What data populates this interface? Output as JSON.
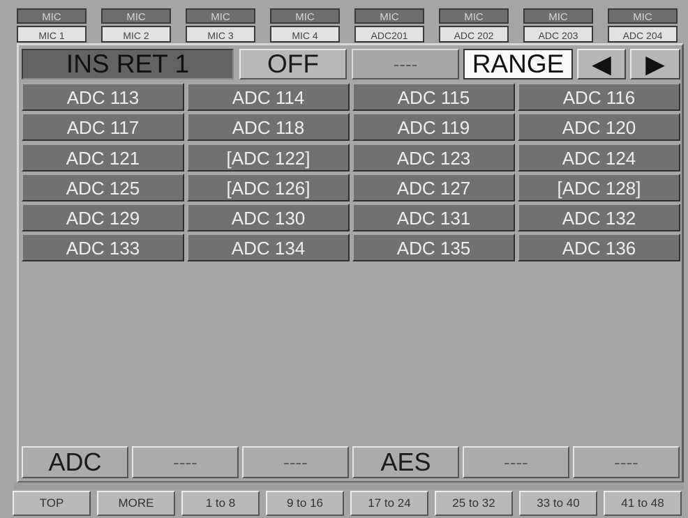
{
  "channel_strip": [
    {
      "category": "MIC",
      "name": "MIC 1"
    },
    {
      "category": "MIC",
      "name": "MIC 2"
    },
    {
      "category": "MIC",
      "name": "MIC 3"
    },
    {
      "category": "MIC",
      "name": "MIC 4"
    },
    {
      "category": "MIC",
      "name": "ADC201"
    },
    {
      "category": "MIC",
      "name": "ADC 202"
    },
    {
      "category": "MIC",
      "name": "ADC 203"
    },
    {
      "category": "MIC",
      "name": "ADC 204"
    }
  ],
  "popup": {
    "title": "INS RET 1",
    "off_label": "OFF",
    "dash_label": "----",
    "range_label": "RANGE",
    "prev_icon": "◀",
    "next_icon": "▶"
  },
  "patch_grid": [
    [
      "ADC 113",
      "ADC 114",
      "ADC 115",
      "ADC 116"
    ],
    [
      "ADC 117",
      "ADC 118",
      "ADC 119",
      "ADC 120"
    ],
    [
      "ADC 121",
      "[ADC 122]",
      "ADC 123",
      "ADC 124"
    ],
    [
      "ADC 125",
      "[ADC 126]",
      "ADC 127",
      "[ADC 128]"
    ],
    [
      "ADC 129",
      "ADC 130",
      "ADC 131",
      "ADC 132"
    ],
    [
      "ADC 133",
      "ADC 134",
      "ADC 135",
      "ADC 136"
    ]
  ],
  "categories": [
    "ADC",
    "----",
    "----",
    "AES",
    "----",
    "----"
  ],
  "footer": [
    "TOP",
    "MORE",
    "1 to 8",
    "9 to 16",
    "17 to 24",
    "25 to 32",
    "33 to 40",
    "41 to 48"
  ]
}
